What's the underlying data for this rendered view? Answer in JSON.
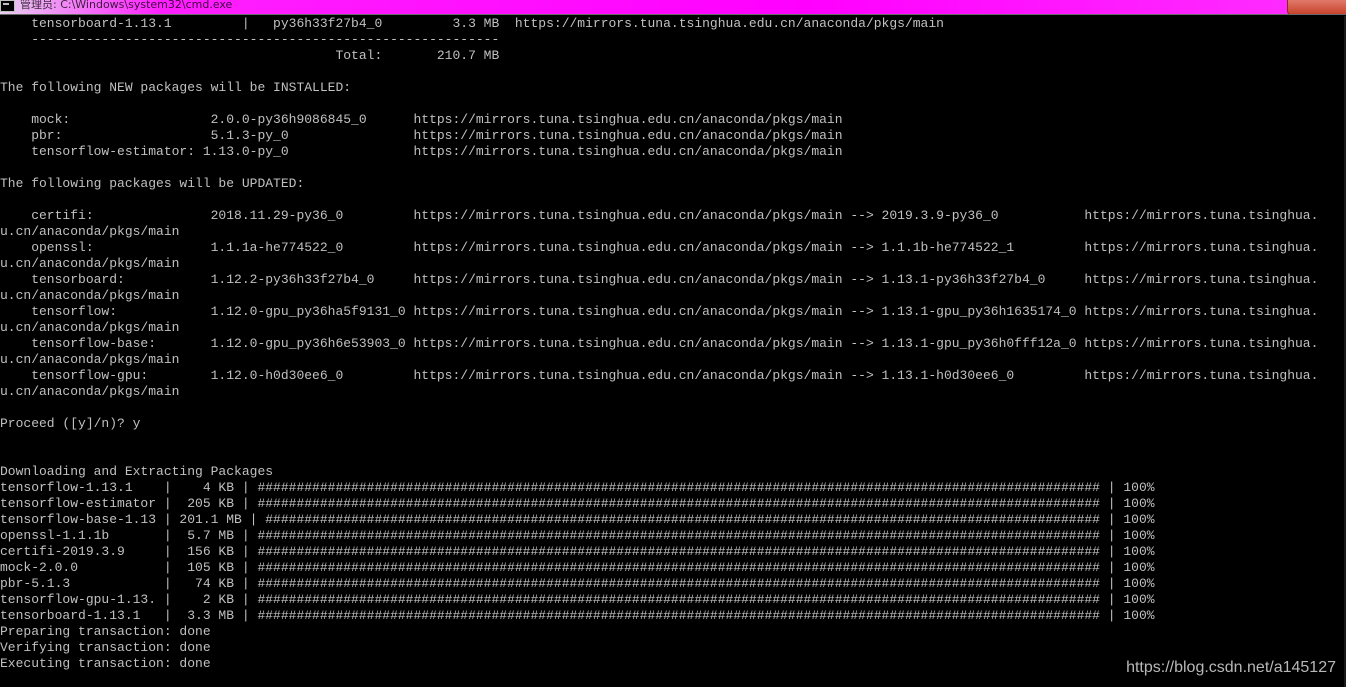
{
  "window": {
    "title": "管理员: C:\\Windows\\system32\\cmd.exe",
    "icon": "console-icon",
    "close_icon": "close-icon"
  },
  "console": {
    "lines": [
      "    tensorboard-1.13.1         |   py36h33f27b4_0         3.3 MB  https://mirrors.tuna.tsinghua.edu.cn/anaconda/pkgs/main",
      "    ------------------------------------------------------------",
      "                                           Total:       210.7 MB",
      "",
      "The following NEW packages will be INSTALLED:",
      "",
      "    mock:                  2.0.0-py36h9086845_0      https://mirrors.tuna.tsinghua.edu.cn/anaconda/pkgs/main",
      "    pbr:                   5.1.3-py_0                https://mirrors.tuna.tsinghua.edu.cn/anaconda/pkgs/main",
      "    tensorflow-estimator: 1.13.0-py_0                https://mirrors.tuna.tsinghua.edu.cn/anaconda/pkgs/main",
      "",
      "The following packages will be UPDATED:",
      "",
      "    certifi:               2018.11.29-py36_0         https://mirrors.tuna.tsinghua.edu.cn/anaconda/pkgs/main --> 2019.3.9-py36_0           https://mirrors.tuna.tsinghua.",
      "u.cn/anaconda/pkgs/main",
      "    openssl:               1.1.1a-he774522_0         https://mirrors.tuna.tsinghua.edu.cn/anaconda/pkgs/main --> 1.1.1b-he774522_1         https://mirrors.tuna.tsinghua.",
      "u.cn/anaconda/pkgs/main",
      "    tensorboard:           1.12.2-py36h33f27b4_0     https://mirrors.tuna.tsinghua.edu.cn/anaconda/pkgs/main --> 1.13.1-py36h33f27b4_0     https://mirrors.tuna.tsinghua.",
      "u.cn/anaconda/pkgs/main",
      "    tensorflow:            1.12.0-gpu_py36ha5f9131_0 https://mirrors.tuna.tsinghua.edu.cn/anaconda/pkgs/main --> 1.13.1-gpu_py36h1635174_0 https://mirrors.tuna.tsinghua.",
      "u.cn/anaconda/pkgs/main",
      "    tensorflow-base:       1.12.0-gpu_py36h6e53903_0 https://mirrors.tuna.tsinghua.edu.cn/anaconda/pkgs/main --> 1.13.1-gpu_py36h0fff12a_0 https://mirrors.tuna.tsinghua.",
      "u.cn/anaconda/pkgs/main",
      "    tensorflow-gpu:        1.12.0-h0d30ee6_0         https://mirrors.tuna.tsinghua.edu.cn/anaconda/pkgs/main --> 1.13.1-h0d30ee6_0         https://mirrors.tuna.tsinghua.",
      "u.cn/anaconda/pkgs/main",
      "",
      "Proceed ([y]/n)? y",
      "",
      "",
      "Downloading and Extracting Packages",
      "tensorflow-1.13.1    |    4 KB | ############################################################################################################ | 100%",
      "tensorflow-estimator |  205 KB | ############################################################################################################ | 100%",
      "tensorflow-base-1.13 | 201.1 MB | ########################################################################################################### | 100%",
      "openssl-1.1.1b       |  5.7 MB | ############################################################################################################ | 100%",
      "certifi-2019.3.9     |  156 KB | ############################################################################################################ | 100%",
      "mock-2.0.0           |  105 KB | ############################################################################################################ | 100%",
      "pbr-5.1.3            |   74 KB | ############################################################################################################ | 100%",
      "tensorflow-gpu-1.13. |    2 KB | ############################################################################################################ | 100%",
      "tensorboard-1.13.1   |  3.3 MB | ############################################################################################################ | 100%",
      "Preparing transaction: done",
      "Verifying transaction: done",
      "Executing transaction: done"
    ]
  },
  "watermark": "https://blog.csdn.net/a145127"
}
